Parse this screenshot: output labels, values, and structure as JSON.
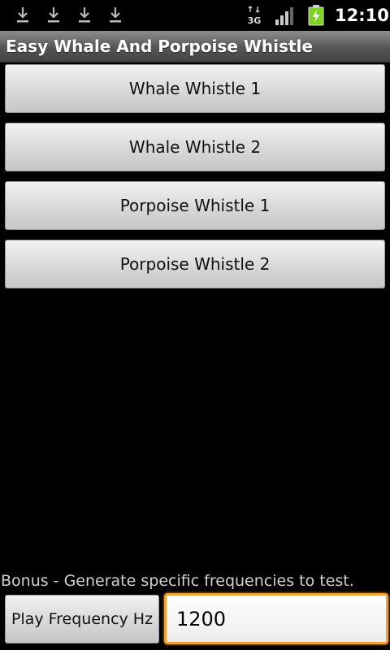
{
  "status_bar": {
    "time": "12:10",
    "network_label": "3G",
    "icons": [
      "download-icon",
      "download-icon",
      "download-icon",
      "download-icon",
      "network-3g-icon",
      "signal-icon",
      "battery-charging-icon"
    ]
  },
  "app": {
    "title": "Easy Whale And Porpoise Whistle"
  },
  "whistles": [
    {
      "label": "Whale Whistle 1"
    },
    {
      "label": "Whale Whistle 2"
    },
    {
      "label": "Porpoise Whistle 1"
    },
    {
      "label": "Porpoise Whistle 2"
    }
  ],
  "bonus": {
    "label": "Bonus - Generate specific frequencies to test.",
    "play_button_label": "Play Frequency Hz",
    "frequency_value": "1200"
  },
  "colors": {
    "background": "#000000",
    "input_focus": "#f0a030",
    "battery_green": "#7ed321"
  }
}
